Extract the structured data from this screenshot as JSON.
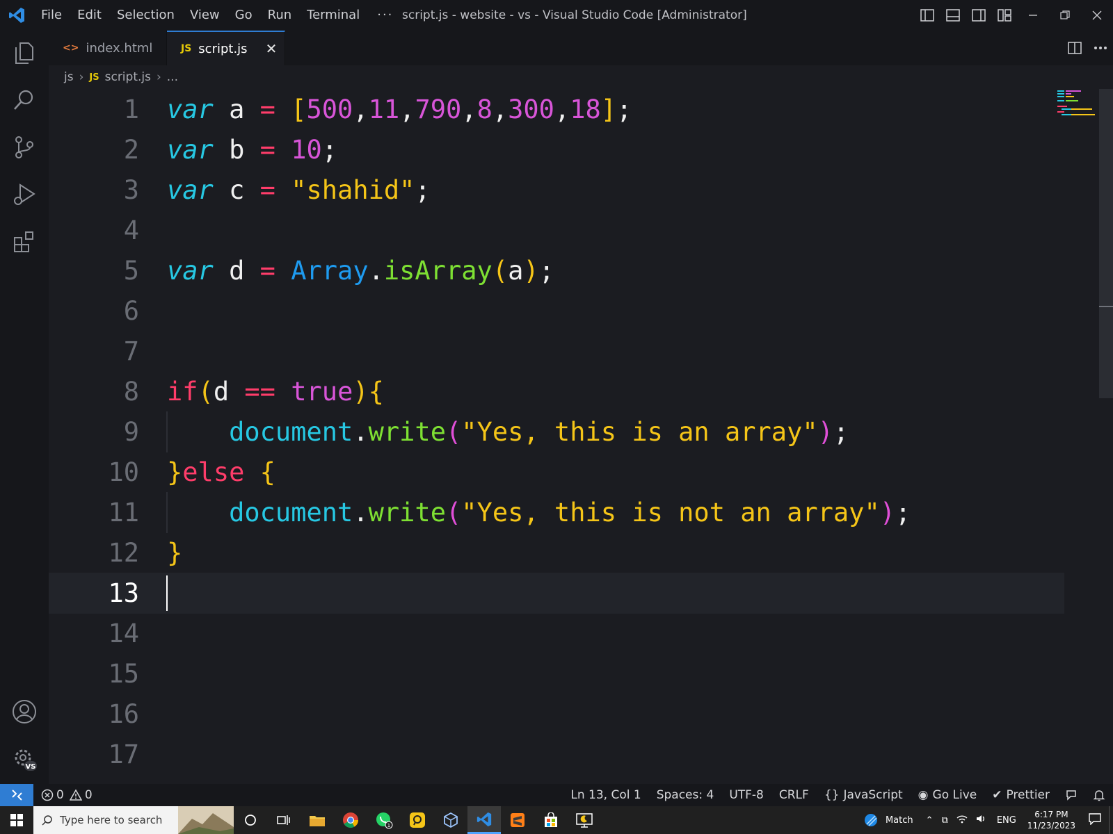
{
  "window": {
    "title": "script.js - website - vs - Visual Studio Code [Administrator]",
    "menu": [
      "File",
      "Edit",
      "Selection",
      "View",
      "Go",
      "Run",
      "Terminal"
    ],
    "more": "···"
  },
  "tabs": [
    {
      "label": "index.html",
      "icon": "<>"
    },
    {
      "label": "script.js",
      "icon": "JS",
      "active": true,
      "close": "✕"
    }
  ],
  "breadcrumb": {
    "folder": "js",
    "file_icon": "JS",
    "file": "script.js",
    "more": "..."
  },
  "editor": {
    "line_numbers": [
      "1",
      "2",
      "3",
      "4",
      "5",
      "6",
      "7",
      "8",
      "9",
      "10",
      "11",
      "12",
      "13",
      "14",
      "15",
      "16",
      "17"
    ],
    "current_line": 13,
    "lines": {
      "l1": {
        "kw": "var",
        "name": " a ",
        "op": "=",
        "open": " [",
        "n1": "500",
        "n2": "11",
        "n3": "790",
        "n4": "8",
        "n5": "300",
        "n6": "18",
        "comma": ",",
        "close": "]",
        "semi": ";"
      },
      "l2": {
        "kw": "var",
        "name": " b ",
        "op": "=",
        "num": " 10",
        "semi": ";"
      },
      "l3": {
        "kw": "var",
        "name": " c ",
        "op": "=",
        "str": " \"shahid\"",
        "semi": ";"
      },
      "l5": {
        "kw": "var",
        "name": " d ",
        "op": "=",
        "cls": " Array",
        "dot": ".",
        "fn": "isArray",
        "po": "(",
        "arg": "a",
        "pc": ")",
        "semi": ";"
      },
      "l8": {
        "ctl": "if",
        "po": "(",
        "var": "d ",
        "op": "==",
        "bool": " true",
        "pc": ")",
        "brace": "{"
      },
      "l9": {
        "indent": "    ",
        "obj": "document",
        "dot": ".",
        "fn": "write",
        "po": "(",
        "str": "\"Yes, this is an array\"",
        "pc": ")",
        "semi": ";"
      },
      "l10": {
        "brace": "}",
        "ctl": "else",
        "sp": " ",
        "open": "{"
      },
      "l11": {
        "indent": "    ",
        "obj": "document",
        "dot": ".",
        "fn": "write",
        "po": "(",
        "str": "\"Yes, this is not an array\"",
        "pc": ")",
        "semi": ";"
      },
      "l12": {
        "brace": "}"
      }
    }
  },
  "status": {
    "errors": "0",
    "warnings": "0",
    "position": "Ln 13, Col 1",
    "spaces": "Spaces: 4",
    "encoding": "UTF-8",
    "eol": "CRLF",
    "language": "JavaScript",
    "golive": "Go Live",
    "prettier": "Prettier"
  },
  "taskbar": {
    "search_placeholder": "Type here to search",
    "weather": "Match",
    "lang": "ENG",
    "time": "6:17 PM",
    "date": "11/23/2023",
    "whatsapp_badge": "1"
  },
  "colors": {
    "accent": "#2f7dd3",
    "keyword": "#27c8e3",
    "operator": "#ff3d6a",
    "number": "#d855d8",
    "string": "#f5c518",
    "function": "#7ee033"
  }
}
